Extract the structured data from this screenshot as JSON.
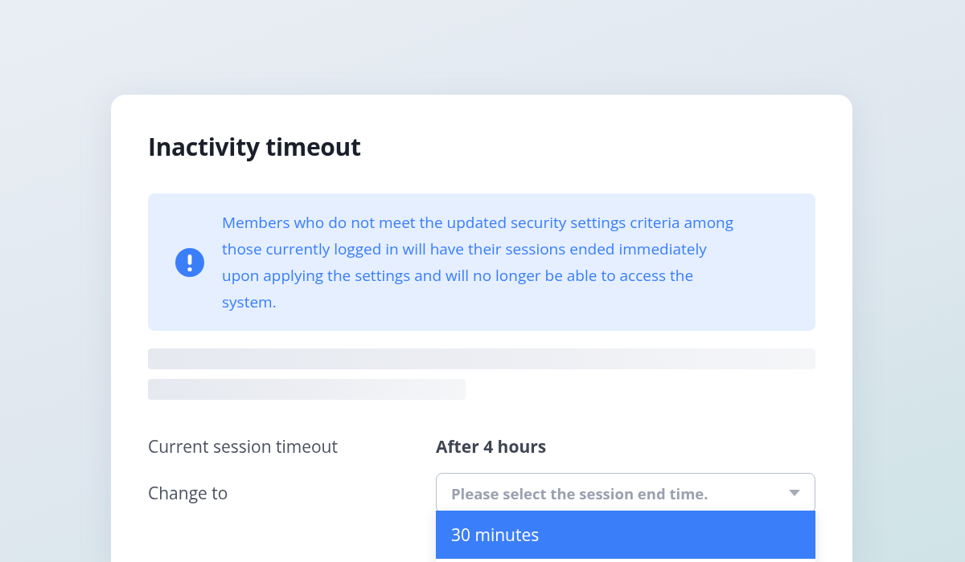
{
  "title": "Inactivity timeout",
  "alert": {
    "message": "Members who do not meet the updated security settings criteria among those currently logged in will have their sessions ended immediately upon applying the settings and will no longer be able to access the system."
  },
  "fields": [
    {
      "kind": "text",
      "label": "Current session timeout",
      "value": "After 4 hours"
    },
    {
      "kind": "select",
      "label": "Change to",
      "placeholder": "Please select the session end time.",
      "expanded": true
    }
  ],
  "options": [
    {
      "label": "30 minutes",
      "selected": true
    }
  ]
}
